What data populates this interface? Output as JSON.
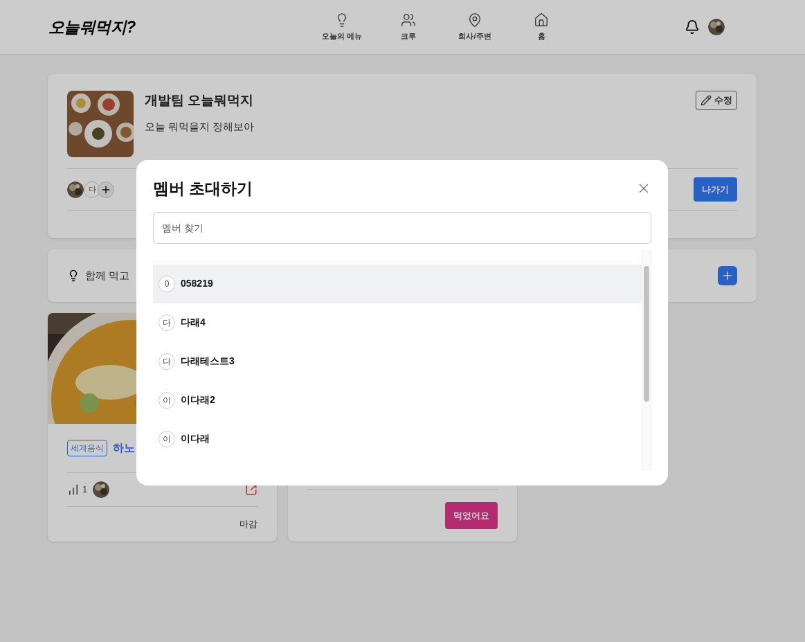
{
  "header": {
    "logo": "오늘뭐먹지?",
    "nav": [
      {
        "label": "오늘의 메뉴"
      },
      {
        "label": "크루"
      },
      {
        "label": "회사/주변"
      },
      {
        "label": "홈"
      }
    ]
  },
  "group": {
    "title": "개발팀 오늘뭐먹지",
    "description": "오늘 뭐먹을지 정해보아",
    "edit_label": "수정",
    "members": [
      {
        "kind": "picture"
      },
      {
        "kind": "initial",
        "text": "다"
      }
    ],
    "leave_label": "나가기"
  },
  "suggest": {
    "text": "함께 먹고"
  },
  "menus": [
    {
      "tag": "세계음식",
      "title": "하노",
      "count": "1",
      "status": "마감"
    },
    {
      "action": "먹었어요"
    }
  ],
  "modal": {
    "title": "멤버 초대하기",
    "search_placeholder": "멤버 찾기",
    "members": [
      {
        "initial": "0",
        "name": "058219",
        "selected": true
      },
      {
        "initial": "다",
        "name": "다래4",
        "selected": false
      },
      {
        "initial": "다",
        "name": "다래테스트3",
        "selected": false
      },
      {
        "initial": "이",
        "name": "이다래2",
        "selected": false
      },
      {
        "initial": "이",
        "name": "이다래",
        "selected": false
      }
    ]
  }
}
